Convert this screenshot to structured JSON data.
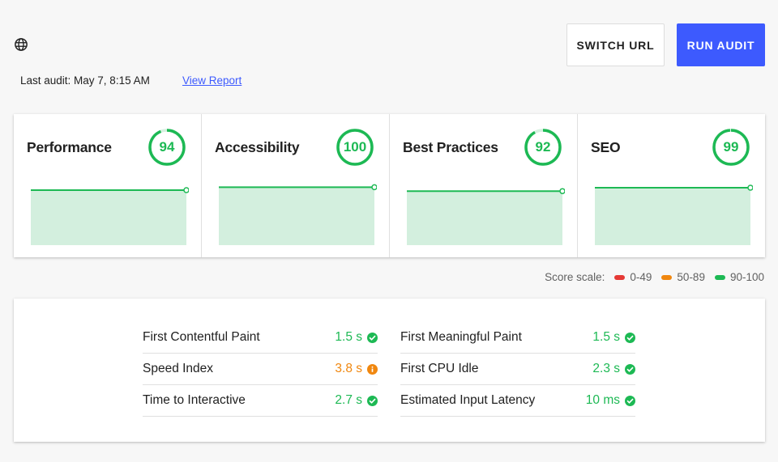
{
  "header": {
    "globe_icon": "globe-icon",
    "last_audit": "Last audit: May 7, 8:15 AM",
    "view_report": "View Report",
    "switch_url": "SWITCH URL",
    "run_audit": "RUN AUDIT"
  },
  "colors": {
    "accent": "#3d5afe",
    "pass": "#1db954",
    "average": "#f0870f",
    "fail": "#e53935",
    "spark_fill": "#d3efde"
  },
  "scores": [
    {
      "title": "Performance",
      "score": "94",
      "value": 94,
      "trend": [
        94,
        94
      ]
    },
    {
      "title": "Accessibility",
      "score": "100",
      "value": 100,
      "trend": [
        100,
        100
      ]
    },
    {
      "title": "Best Practices",
      "score": "92",
      "value": 92,
      "trend": [
        92,
        92
      ]
    },
    {
      "title": "SEO",
      "score": "99",
      "value": 99,
      "trend": [
        99,
        99
      ]
    }
  ],
  "scale": {
    "label": "Score scale:",
    "fail": "0-49",
    "average": "50-89",
    "pass": "90-100"
  },
  "metrics": {
    "left": [
      {
        "label": "First Contentful Paint",
        "value": "1.5 s",
        "status": "pass"
      },
      {
        "label": "Speed Index",
        "value": "3.8 s",
        "status": "average"
      },
      {
        "label": "Time to Interactive",
        "value": "2.7 s",
        "status": "pass"
      }
    ],
    "right": [
      {
        "label": "First Meaningful Paint",
        "value": "1.5 s",
        "status": "pass"
      },
      {
        "label": "First CPU Idle",
        "value": "2.3 s",
        "status": "pass"
      },
      {
        "label": "Estimated Input Latency",
        "value": "10 ms",
        "status": "pass"
      }
    ]
  }
}
